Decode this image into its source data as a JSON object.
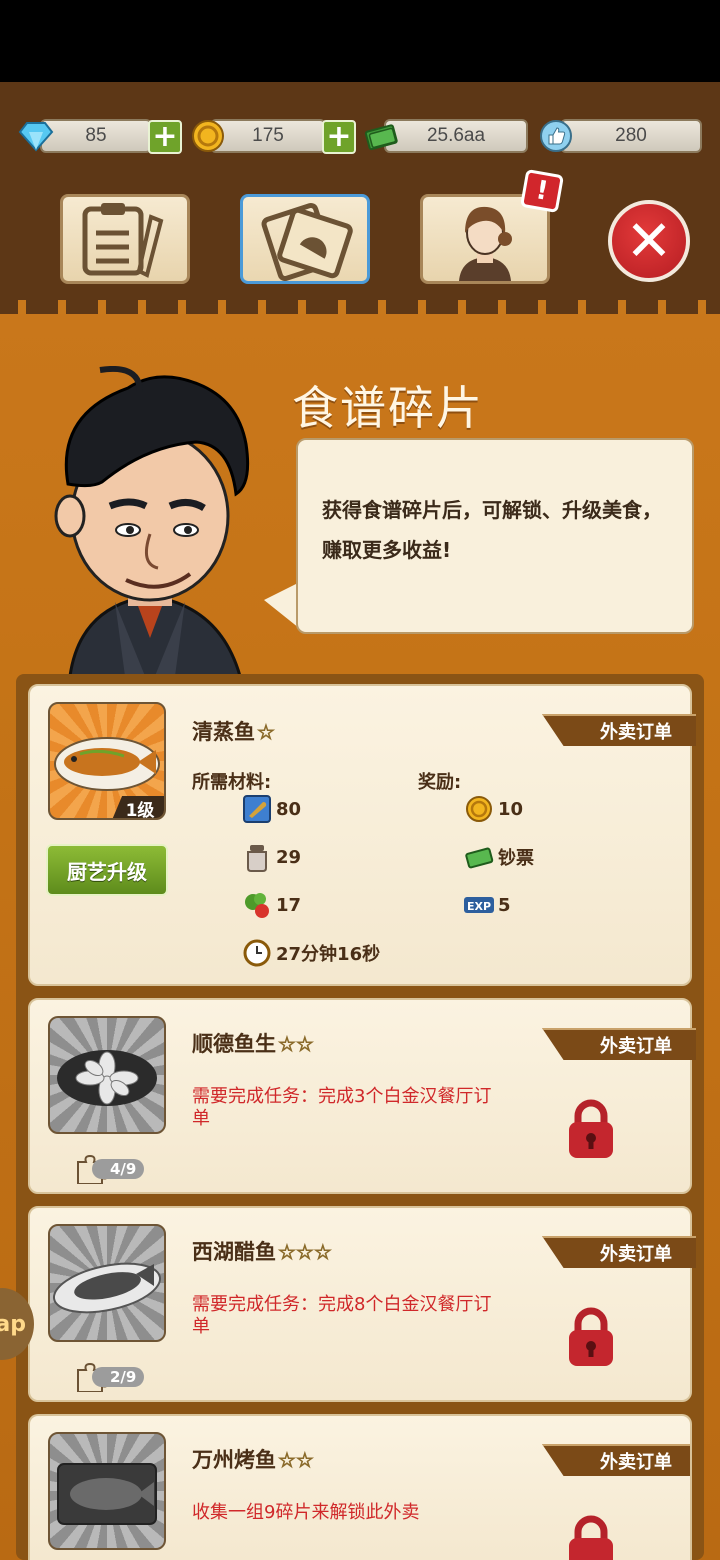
{
  "resources": {
    "diamonds": "85",
    "coins": "175",
    "cash": "25.6aa",
    "likes": "280"
  },
  "tabs": [
    {
      "name": "task-list",
      "active": false
    },
    {
      "name": "recipe-cards",
      "active": true
    },
    {
      "name": "staff",
      "active": false
    }
  ],
  "alert_badge": "!",
  "close_symbol": "✕",
  "header": {
    "title": "食谱碎片",
    "message": "获得食谱碎片后，可解锁、升级美食，赚取更多收益!"
  },
  "recipes": [
    {
      "name": "清蒸鱼",
      "stars": "☆",
      "ribbon": "外卖订单",
      "level": "1级",
      "upgrade_label": "厨艺升级",
      "materials_label": "所需材料:",
      "rewards_label": "奖励:",
      "materials": [
        {
          "icon": "fish-ingredient-icon",
          "amount": "80"
        },
        {
          "icon": "salt-jar-icon",
          "amount": "29"
        },
        {
          "icon": "vegetables-icon",
          "amount": "17"
        }
      ],
      "rewards": [
        {
          "icon": "coin-icon",
          "amount": "10"
        },
        {
          "icon": "cash-icon",
          "amount": "钞票"
        },
        {
          "icon": "exp-icon",
          "amount": "5"
        }
      ],
      "time": "27分钟16秒"
    },
    {
      "name": "顺德鱼生",
      "stars": "☆☆",
      "ribbon": "外卖订单",
      "task": "需要完成任务：完成3个白金汉餐厅订单",
      "fragments": "4/9"
    },
    {
      "name": "西湖醋鱼",
      "stars": "☆☆☆",
      "ribbon": "外卖订单",
      "task": "需要完成任务：完成8个白金汉餐厅订单",
      "fragments": "2/9"
    },
    {
      "name": "万州烤鱼",
      "stars": "☆☆",
      "ribbon": "外卖订单",
      "task": "收集一组9碎片来解锁此外卖"
    }
  ],
  "side_button": "ap",
  "colors": {
    "background": "#c57417",
    "topbar": "#5d3716",
    "accent_green": "#6fa32a",
    "alert_red": "#d1262c",
    "task_red": "#d0282a"
  }
}
